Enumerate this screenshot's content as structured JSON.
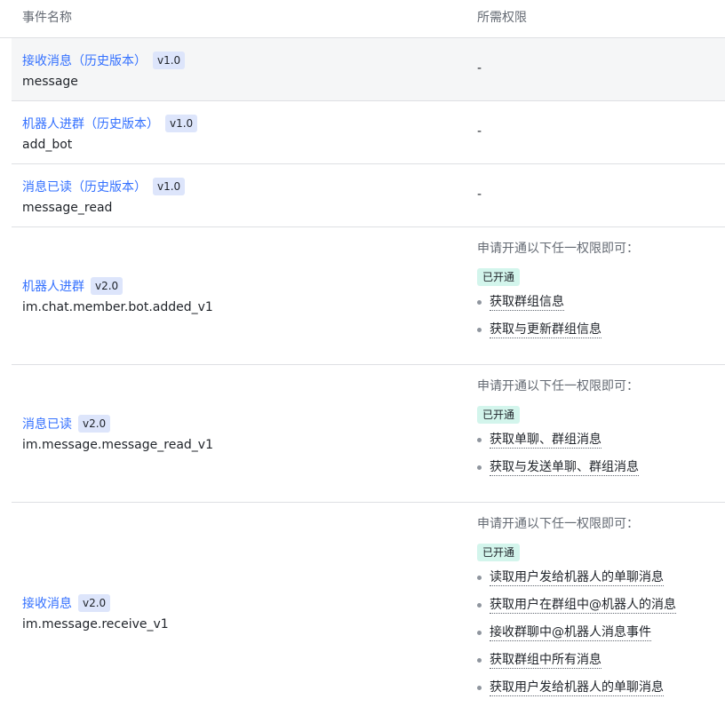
{
  "header": {
    "col_event": "事件名称",
    "col_perm": "所需权限"
  },
  "rows": [
    {
      "name": "接收消息（历史版本）",
      "version": "v1.0",
      "key": "message",
      "perm": "-"
    },
    {
      "name": "机器人进群（历史版本）",
      "version": "v1.0",
      "key": "add_bot",
      "perm": "-"
    },
    {
      "name": "消息已读（历史版本）",
      "version": "v1.0",
      "key": "message_read",
      "perm": "-"
    },
    {
      "name": "机器人进群",
      "version": "v2.0",
      "key": "im.chat.member.bot.added_v1",
      "perm_title": "申请开通以下任一权限即可：",
      "status": "已开通",
      "perms": [
        "获取群组信息",
        "获取与更新群组信息"
      ]
    },
    {
      "name": "消息已读",
      "version": "v2.0",
      "key": "im.message.message_read_v1",
      "perm_title": "申请开通以下任一权限即可：",
      "status": "已开通",
      "perms": [
        "获取单聊、群组消息",
        "获取与发送单聊、群组消息"
      ]
    },
    {
      "name": "接收消息",
      "version": "v2.0",
      "key": "im.message.receive_v1",
      "perm_title": "申请开通以下任一权限即可：",
      "status": "已开通",
      "perms": [
        "读取用户发给机器人的单聊消息",
        "获取用户在群组中@机器人的消息",
        "接收群聊中@机器人消息事件",
        "获取群组中所有消息",
        "获取用户发给机器人的单聊消息"
      ]
    }
  ],
  "colors": {
    "link": "#3370ff",
    "badge_bg": "#dde5fb",
    "status_bg": "#d3f5ec",
    "row_gray": "#f5f6f7",
    "border": "#dee0e3"
  }
}
